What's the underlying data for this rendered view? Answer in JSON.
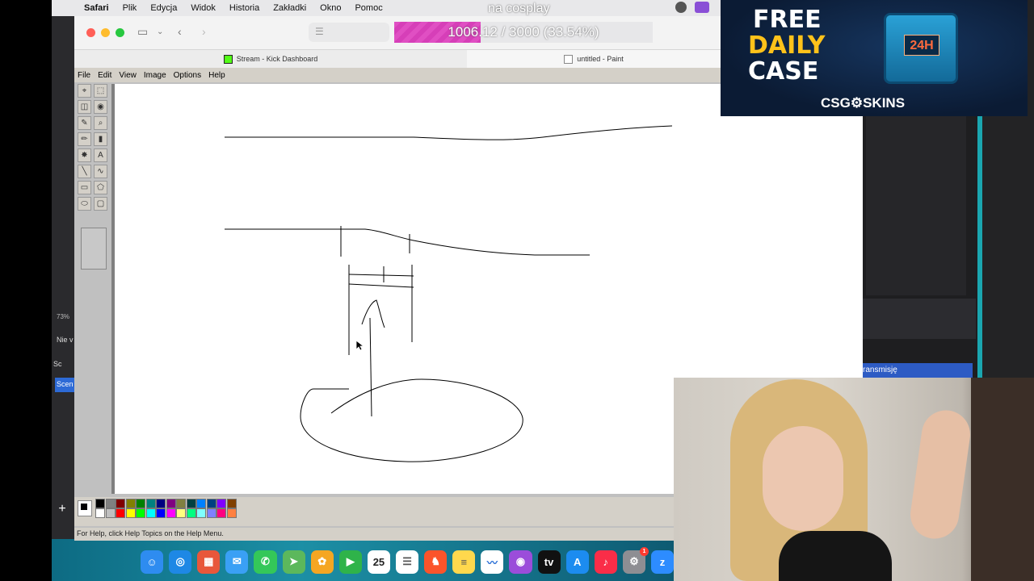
{
  "menubar": {
    "app_name": "Safari",
    "items": [
      "Plik",
      "Edycja",
      "Widok",
      "Historia",
      "Zakładki",
      "Okno",
      "Pomoc"
    ],
    "overlay_text": "na cosplay"
  },
  "safari": {
    "address_icon": "reader-icon",
    "goal": {
      "text": "1006.12 / 3000 (33.54%)",
      "fraction": 0.3354,
      "color": "#e04fc3"
    },
    "tabs": [
      {
        "label": "Stream - Kick Dashboard",
        "icon": "kick-icon"
      },
      {
        "label": "untitled - Paint",
        "icon": "paint-icon"
      }
    ]
  },
  "paint": {
    "menu": [
      "File",
      "Edit",
      "View",
      "Image",
      "Options",
      "Help"
    ],
    "tools": [
      "free-select",
      "rect-select",
      "eraser",
      "fill",
      "picker",
      "magnifier",
      "pencil",
      "brush",
      "airbrush",
      "text",
      "line",
      "curve",
      "rectangle",
      "polygon",
      "ellipse",
      "rounded-rect"
    ],
    "tool_glyphs": [
      "⌖",
      "⬚",
      "◫",
      "◉",
      "✎",
      "⌕",
      "✏",
      "▮",
      "✸",
      "A",
      "╲",
      "∿",
      "▭",
      "⬠",
      "⬭",
      "▢"
    ],
    "palette": [
      "#000000",
      "#808080",
      "#800000",
      "#808000",
      "#008000",
      "#008080",
      "#000080",
      "#800080",
      "#808040",
      "#004040",
      "#0080ff",
      "#004080",
      "#8000ff",
      "#804000",
      "#ffffff",
      "#c0c0c0",
      "#ff0000",
      "#ffff00",
      "#00ff00",
      "#00ffff",
      "#0000ff",
      "#ff00ff",
      "#ffff80",
      "#00ff80",
      "#80ffff",
      "#8080ff",
      "#ff0080",
      "#ff8040"
    ],
    "status": "For Help, click Help Topics on the Help Menu."
  },
  "background": {
    "zoom": "73%",
    "label_nie": "Nie v",
    "label_sc": "Sc",
    "label_scene": "Scen",
    "button_text": "ransmisję",
    "plus": "+"
  },
  "dock": {
    "apps": [
      {
        "name": "finder",
        "color": "#2e8cf0",
        "glyph": "☺"
      },
      {
        "name": "safari",
        "color": "#1e88e5",
        "glyph": "◎"
      },
      {
        "name": "launchpad",
        "color": "#e8573b",
        "glyph": "▦"
      },
      {
        "name": "mail",
        "color": "#3aa0f5",
        "glyph": "✉"
      },
      {
        "name": "messages",
        "color": "#34c759",
        "glyph": "✆"
      },
      {
        "name": "maps",
        "color": "#5cb85c",
        "glyph": "➤"
      },
      {
        "name": "photos",
        "color": "#f5a623",
        "glyph": "✿"
      },
      {
        "name": "facetime",
        "color": "#2fb34a",
        "glyph": "▶"
      },
      {
        "name": "calendar",
        "color": "#ffffff",
        "glyph": "25",
        "fg": "#222"
      },
      {
        "name": "reminders",
        "color": "#ffffff",
        "glyph": "☰",
        "fg": "#555"
      },
      {
        "name": "brave",
        "color": "#fb542b",
        "glyph": "♞"
      },
      {
        "name": "notes",
        "color": "#ffd84d",
        "glyph": "≡",
        "fg": "#555"
      },
      {
        "name": "freeform",
        "color": "#ffffff",
        "glyph": "〰",
        "fg": "#2a6fd6"
      },
      {
        "name": "podcasts",
        "color": "#9b4dda",
        "glyph": "◉"
      },
      {
        "name": "tv",
        "color": "#111111",
        "glyph": "tv"
      },
      {
        "name": "app-store",
        "color": "#1c8cf0",
        "glyph": "A"
      },
      {
        "name": "music",
        "color": "#fa2d48",
        "glyph": "♪"
      },
      {
        "name": "settings",
        "color": "#8e8e93",
        "glyph": "⚙",
        "badge": "1"
      },
      {
        "name": "zoom",
        "color": "#2d8cff",
        "glyph": "z"
      }
    ]
  },
  "ad": {
    "line1": "FREE",
    "line2": "DAILY",
    "line3": "CASE",
    "crate_label": "24H",
    "brand": "CSG⚙SKINS",
    "accent": "#ffc21a"
  }
}
